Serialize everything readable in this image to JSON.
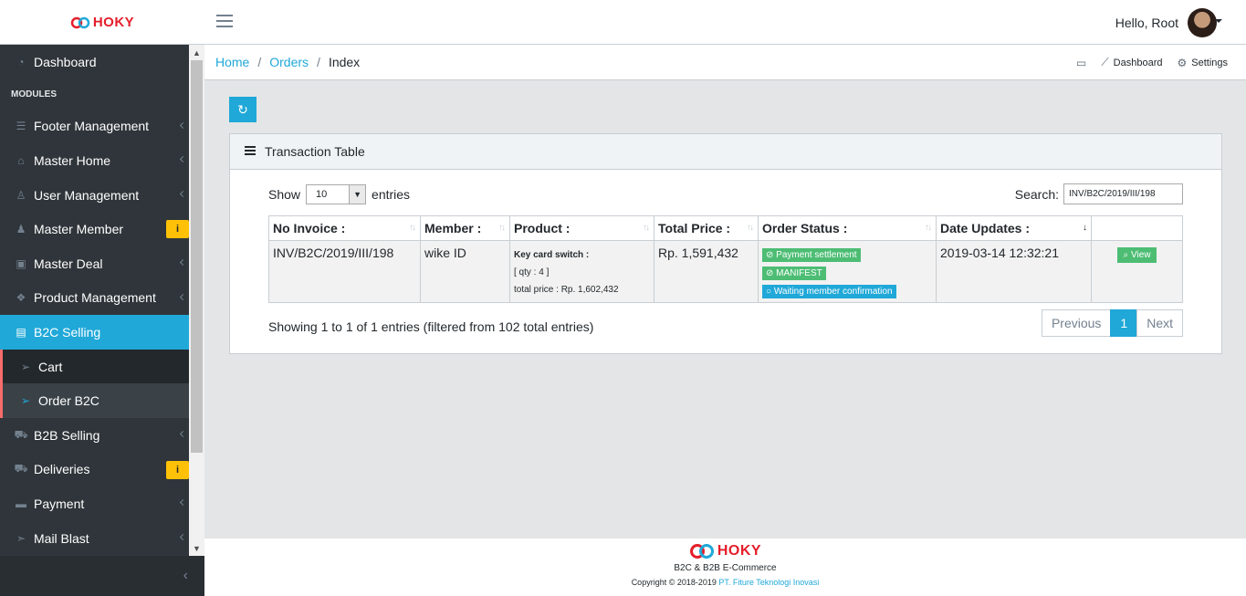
{
  "brand": {
    "logo_text": "HOKY",
    "logo_color": "#e41e2b"
  },
  "header": {
    "greeting": "Hello, Root"
  },
  "sidebar": {
    "dashboard": "Dashboard",
    "section_title": "MODULES",
    "items": [
      {
        "label": "Footer Management",
        "icon": "list-icon"
      },
      {
        "label": "Master Home",
        "icon": "home-icon"
      },
      {
        "label": "User Management",
        "icon": "user-icon"
      },
      {
        "label": "Master Member",
        "icon": "users-icon",
        "badge": "i"
      },
      {
        "label": "Master Deal",
        "icon": "money-icon"
      },
      {
        "label": "Product Management",
        "icon": "cubes-icon"
      },
      {
        "label": "B2C Selling",
        "icon": "clipboard-icon",
        "active": true
      },
      {
        "label": "Cart",
        "icon": "send-icon",
        "sub": true
      },
      {
        "label": "Order B2C",
        "icon": "send-icon",
        "sub": true,
        "current": true
      },
      {
        "label": "B2B Selling",
        "icon": "cart-icon"
      },
      {
        "label": "Deliveries",
        "icon": "truck-icon",
        "badge": "i"
      },
      {
        "label": "Payment",
        "icon": "credit-card-icon"
      },
      {
        "label": "Mail Blast",
        "icon": "paper-plane-icon"
      }
    ]
  },
  "breadcrumb": {
    "home": "Home",
    "orders": "Orders",
    "current": "Index",
    "menu": {
      "dashboard": "Dashboard",
      "settings": "Settings"
    }
  },
  "card": {
    "title": "Transaction Table",
    "show_label": "Show",
    "entries_label": "entries",
    "page_length": "10",
    "search_label": "Search:",
    "search_value": "INV/B2C/2019/III/198",
    "columns": [
      "No Invoice :",
      "Member :",
      "Product :",
      "Total Price :",
      "Order Status :",
      "Date Updates :"
    ],
    "row": {
      "invoice": "INV/B2C/2019/III/198",
      "member": "wike ID",
      "product_name": "Key card switch :",
      "product_qty": "[ qty : 4 ]",
      "product_total": "total price : Rp. 1,602,432",
      "total_price": "Rp. 1,591,432",
      "status_1": "Payment settlement",
      "status_2": "MANIFEST",
      "status_3": "Waiting member confirmation",
      "date": "2019-03-14 12:32:21",
      "view": "View"
    },
    "info": "Showing 1 to 1 of 1 entries (filtered from 102 total entries)",
    "pager": {
      "previous": "Previous",
      "page": "1",
      "next": "Next"
    }
  },
  "footer": {
    "logo_text": "HOKY",
    "tagline": "B2C & B2B E-Commerce",
    "copyright": "Copyright © 2018-2019",
    "company": "PT. Fiture Teknologi Inovasi"
  },
  "colors": {
    "primary": "#20a8d8",
    "success": "#4dbd74",
    "warning": "#ffc107",
    "sidebar": "#2f353a"
  }
}
